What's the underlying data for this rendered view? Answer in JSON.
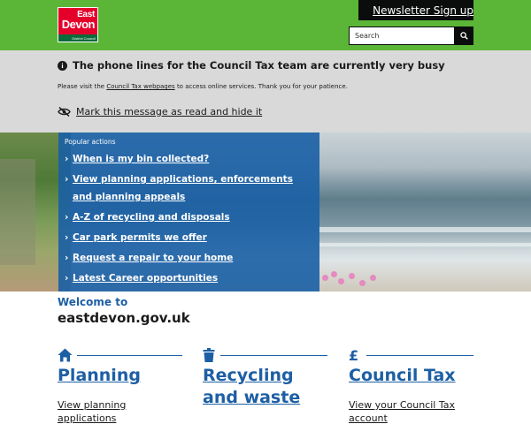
{
  "header": {
    "logo": {
      "line1": "East",
      "line2": "Devon",
      "line3": "District Council"
    },
    "newsletter_label": "Newsletter Sign up",
    "search": {
      "placeholder": "Search"
    },
    "colors": {
      "brand_green": "#5bb537",
      "dark": "#0b0c0c"
    }
  },
  "alert": {
    "title": "The phone lines for the Council Tax team are currently very busy",
    "text_before": "Please visit the",
    "link": "Council Tax webpages",
    "text_after": "to access online services. Thank you for your patience.",
    "dismiss_label": "Mark this message as read and hide it"
  },
  "popular_actions": {
    "heading": "Popular actions",
    "items": [
      {
        "label": "When is my bin collected?"
      },
      {
        "label": "View planning applications, enforcements and planning appeals"
      },
      {
        "label": "A-Z of recycling and disposals"
      },
      {
        "label": "Car park permits we offer"
      },
      {
        "label": "Request a repair to your home"
      },
      {
        "label": "Latest Career opportunities"
      }
    ]
  },
  "welcome": {
    "subtitle": "Welcome to",
    "title": "eastdevon.gov.uk"
  },
  "cards": [
    {
      "title": "Planning",
      "icon": "home-icon",
      "link": "View planning applications"
    },
    {
      "title": "Recycling and waste",
      "icon": "bin-icon",
      "link": ""
    },
    {
      "title": "Council Tax",
      "icon": "pound-icon",
      "icon_glyph": "£",
      "link": "View your Council Tax account"
    }
  ]
}
